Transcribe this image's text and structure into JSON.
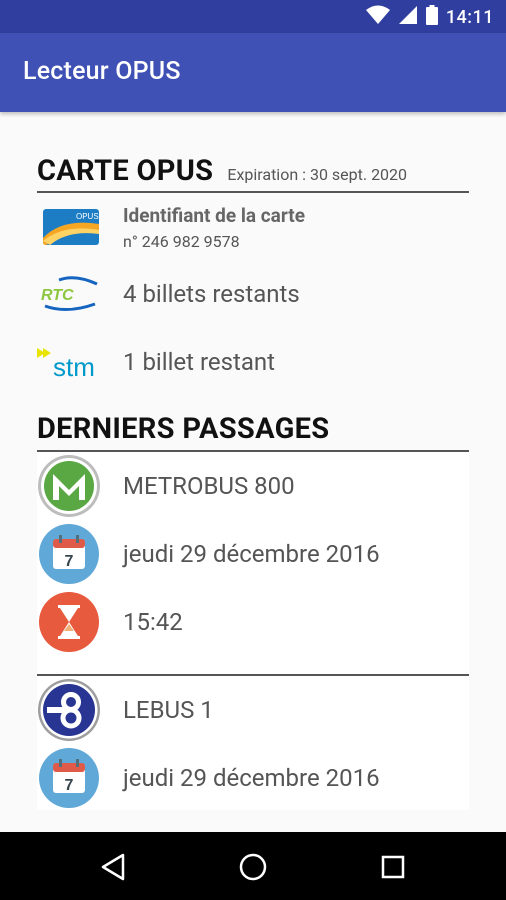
{
  "status_bar": {
    "time": "14:11"
  },
  "app_bar": {
    "title": "Lecteur OPUS"
  },
  "card": {
    "section_title": "CARTE OPUS",
    "expiration": "Expiration : 30 sept. 2020",
    "identifier_label": "Identifiant de la carte",
    "identifier_number": "n° 246 982 9578",
    "opus_logo_text": "OPUS",
    "rtc": {
      "logo_text": "RTC",
      "tickets": "4 billets restants"
    },
    "stm": {
      "logo_text": "stm",
      "tickets": "1 billet restant"
    }
  },
  "trips": {
    "section_title": "DERNIERS PASSAGES",
    "items": [
      {
        "route": "METROBUS 800",
        "date": "jeudi 29 décembre 2016",
        "time": "15:42",
        "calendar_day": "7"
      },
      {
        "route": "LEBUS 1",
        "date": "jeudi 29 décembre 2016",
        "calendar_day": "7"
      }
    ]
  }
}
